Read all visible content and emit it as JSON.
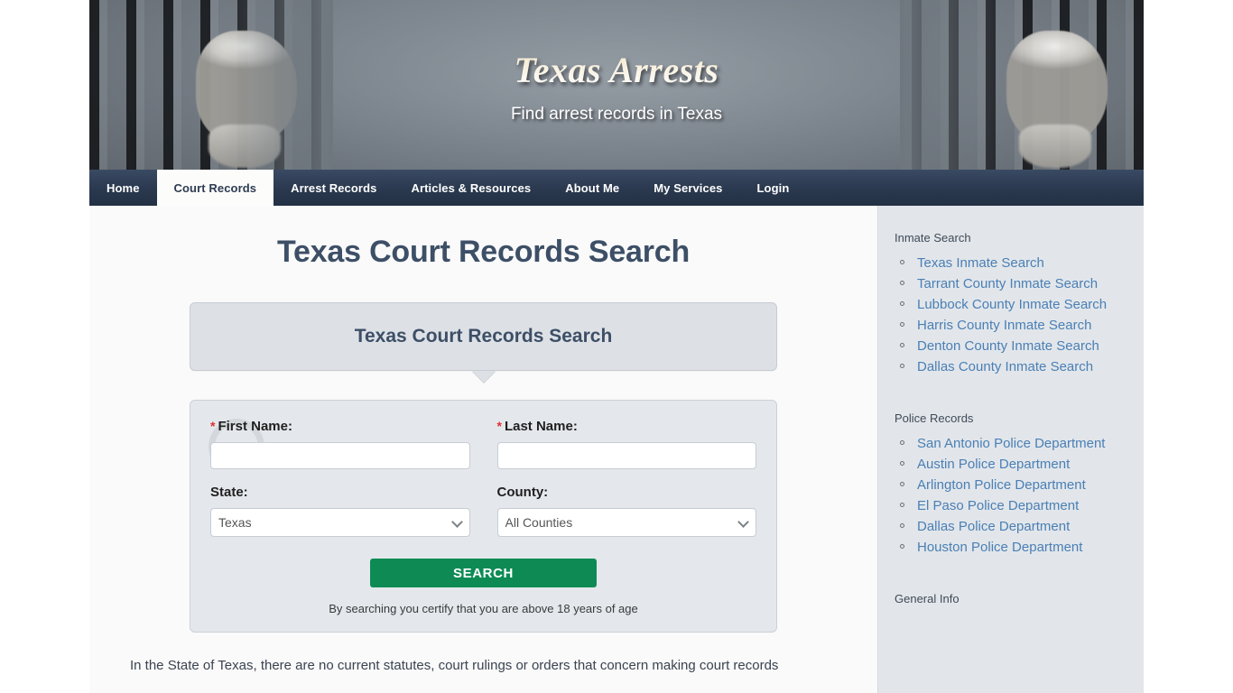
{
  "site": {
    "title": "Texas Arrests",
    "tagline": "Find arrest records in Texas"
  },
  "nav": {
    "items": [
      {
        "label": "Home",
        "active": false
      },
      {
        "label": "Court Records",
        "active": true
      },
      {
        "label": "Arrest Records",
        "active": false
      },
      {
        "label": "Articles & Resources",
        "active": false
      },
      {
        "label": "About Me",
        "active": false
      },
      {
        "label": "My Services",
        "active": false
      },
      {
        "label": "Login",
        "active": false
      }
    ]
  },
  "main": {
    "page_title": "Texas Court Records Search",
    "callout_title": "Texas Court Records Search",
    "paragraph": "In the State of Texas, there are no current statutes, court rulings or orders that concern making court records"
  },
  "form": {
    "first_name": {
      "label": "First Name:",
      "required_mark": "*",
      "value": "",
      "placeholder": ""
    },
    "last_name": {
      "label": "Last Name:",
      "required_mark": "*",
      "value": "",
      "placeholder": ""
    },
    "state": {
      "label": "State:",
      "selected": "Texas",
      "options": [
        "Texas"
      ]
    },
    "county": {
      "label": "County:",
      "selected": "All Counties",
      "options": [
        "All Counties"
      ]
    },
    "search_button": "SEARCH",
    "disclaimer": "By searching you certify that you are above 18 years of age"
  },
  "sidebar": {
    "sections": [
      {
        "heading": "Inmate Search",
        "links": [
          "Texas Inmate Search",
          "Tarrant County Inmate Search",
          "Lubbock County Inmate Search",
          "Harris County Inmate Search",
          "Denton County Inmate Search",
          "Dallas County Inmate Search"
        ]
      },
      {
        "heading": "Police Records",
        "links": [
          "San Antonio Police Department",
          "Austin Police Department",
          "Arlington Police Department",
          "El Paso Police Department",
          "Dallas Police Department",
          "Houston Police Department"
        ]
      },
      {
        "heading": "General Info",
        "links": []
      }
    ]
  },
  "colors": {
    "nav_bg": "#2b3a50",
    "accent_heading": "#3d4f66",
    "link_blue": "#4a7fb5",
    "button_green": "#0e8b55",
    "sidebar_bg": "#e2e6ea",
    "required_red": "#e03131"
  }
}
